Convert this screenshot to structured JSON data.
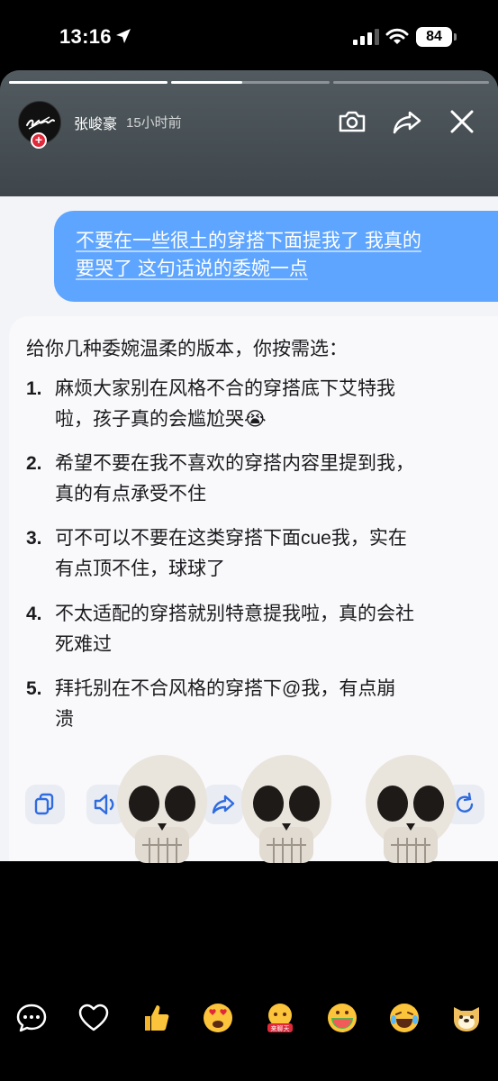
{
  "status_bar": {
    "time": "13:16",
    "battery": "84",
    "icons": [
      "location-arrow-icon",
      "cellular-signal-icon",
      "wifi-icon",
      "battery-icon"
    ]
  },
  "story": {
    "progress_segments": [
      1,
      0.45,
      0
    ],
    "author_name": "张峻豪",
    "posted_ago": "15小时前",
    "avatar_badge": "+",
    "header_icons": [
      "camera-icon",
      "share-icon",
      "close-icon"
    ]
  },
  "chat": {
    "user_message_lines": [
      "不要在一些很土的穿搭下面提我了 我真的",
      "要哭了 这句话说的委婉一点"
    ],
    "reply_intro": "给你几种委婉温柔的版本，你按需选：",
    "reply_items": [
      {
        "num": "1.",
        "lines": [
          "麻烦大家别在风格不合的穿搭底下艾特我",
          "啦，孩子真的会尴尬哭😭"
        ]
      },
      {
        "num": "2.",
        "lines": [
          "希望不要在我不喜欢的穿搭内容里提到我，",
          "真的有点承受不住"
        ]
      },
      {
        "num": "3.",
        "lines": [
          "可不可以不要在这类穿搭下面cue我，实在",
          "有点顶不住，球球了"
        ]
      },
      {
        "num": "4.",
        "lines": [
          "不太适配的穿搭就别特意提我啦，真的会社",
          "死难过"
        ]
      },
      {
        "num": "5.",
        "lines": [
          "拜托别在不合风格的穿搭下@我，有点崩",
          "溃"
        ]
      }
    ],
    "toolbar_icons": [
      "copy-icon",
      "speaker-icon",
      "share-arrow-icon",
      "refresh-icon"
    ]
  },
  "overlay": {
    "stickers": [
      "skull-emoji",
      "skull-emoji",
      "skull-emoji"
    ]
  },
  "reactions": {
    "items": [
      "comment-icon",
      "heart-icon",
      "thumbs-up-emoji",
      "heart-eyes-emoji",
      "chat-emoji",
      "watermelon-emoji",
      "laughing-emoji",
      "dog-emoji"
    ],
    "chat_emoji_label": "来聊天"
  },
  "colors": {
    "user_bubble": "#5ea5ff",
    "story_header": "#4a5256",
    "badge_red": "#e0293a"
  }
}
